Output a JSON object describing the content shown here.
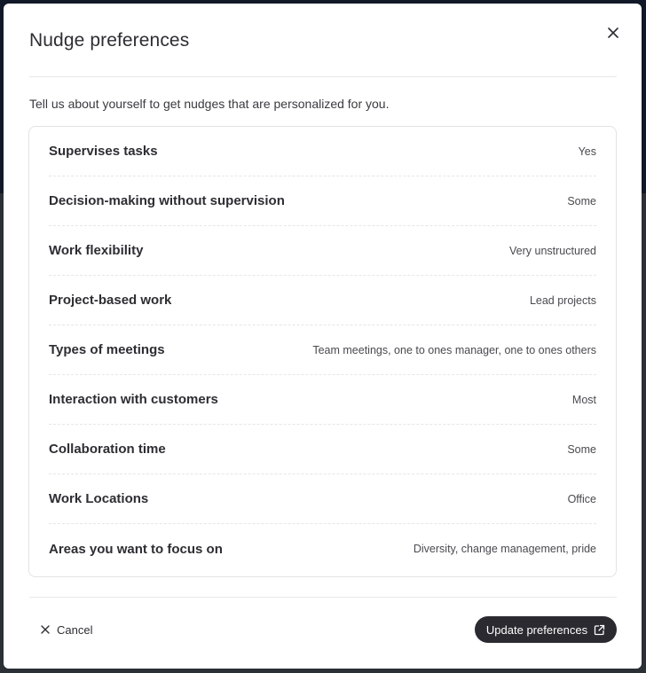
{
  "modal": {
    "title": "Nudge preferences",
    "intro": "Tell us about yourself to get nudges that are personalized for you."
  },
  "preferences": [
    {
      "label": "Supervises tasks",
      "value": "Yes"
    },
    {
      "label": "Decision-making without supervision",
      "value": "Some"
    },
    {
      "label": "Work flexibility",
      "value": "Very unstructured"
    },
    {
      "label": "Project-based work",
      "value": "Lead projects"
    },
    {
      "label": "Types of meetings",
      "value": "Team meetings, one to ones manager, one to ones others"
    },
    {
      "label": "Interaction with customers",
      "value": "Most"
    },
    {
      "label": "Collaboration time",
      "value": "Some"
    },
    {
      "label": "Work Locations",
      "value": "Office"
    },
    {
      "label": "Areas you want to focus on",
      "value": "Diversity, change management, pride"
    }
  ],
  "footer": {
    "cancel_label": "Cancel",
    "update_label": "Update preferences"
  },
  "icons": {
    "close": "close-icon",
    "cancel": "close-icon",
    "external": "external-link-icon"
  },
  "colors": {
    "primary_button": "#2a2a30",
    "text": "#2d2d33",
    "border": "#e3e3e6"
  }
}
